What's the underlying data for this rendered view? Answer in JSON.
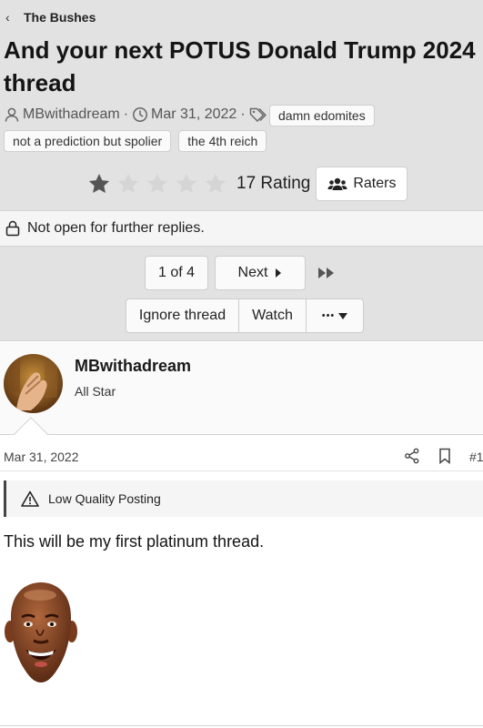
{
  "breadcrumb": {
    "label": "The Bushes",
    "icon": "chevron-left-icon"
  },
  "thread": {
    "title": "And your next POTUS Donald Trump 2024 thread",
    "author": "MBwithadream",
    "date": "Mar 31, 2022",
    "tags": [
      "damn edomites",
      "not a prediction but spolier",
      "the 4th reich"
    ]
  },
  "rating": {
    "stars_filled": 1,
    "stars_total": 5,
    "text": "17 Rating",
    "raters_label": "Raters"
  },
  "locked": {
    "text": "Not open for further replies."
  },
  "pagination": {
    "current": "1 of 4",
    "next_label": "Next"
  },
  "thread_actions": {
    "ignore_label": "Ignore thread",
    "watch_label": "Watch",
    "more_label": "•••"
  },
  "post": {
    "username": "MBwithadream",
    "user_title": "All Star",
    "date": "Mar 31, 2022",
    "number": "#1",
    "notice": "Low Quality Posting",
    "body": "This will be my first platinum thread."
  },
  "colors": {
    "header_bg": "#e2e2e2",
    "star_filled": "#555555",
    "star_empty": "#d5d5d5"
  }
}
